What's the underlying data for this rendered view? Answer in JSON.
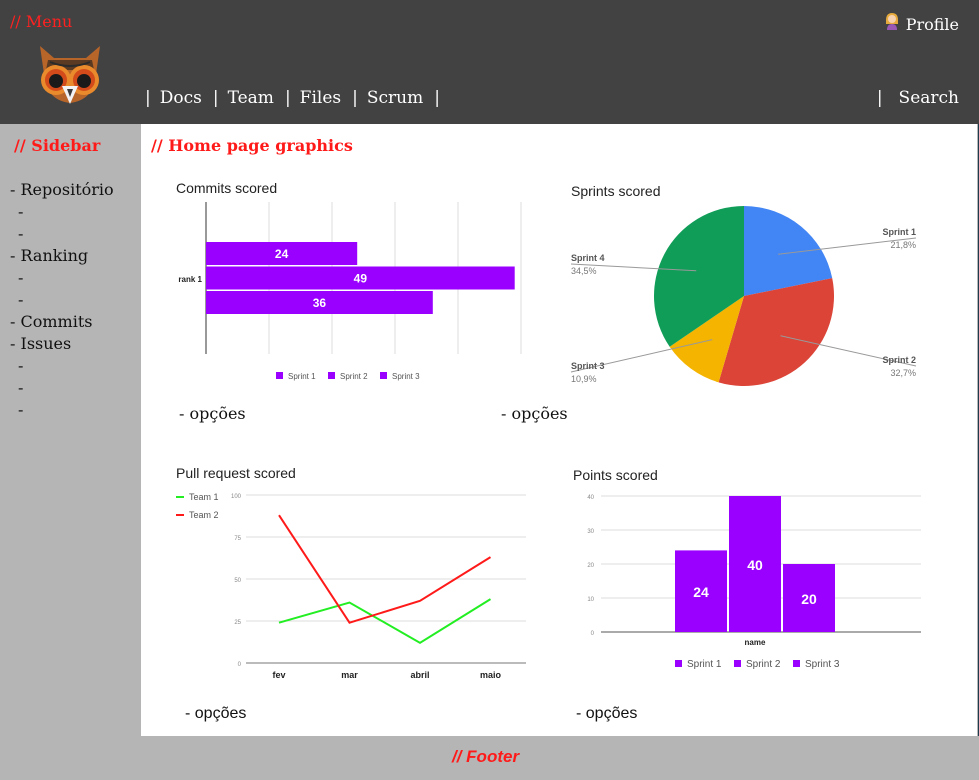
{
  "header": {
    "menu_label": "// Menu",
    "profile_label": "Profile",
    "nav": [
      "Docs",
      "Team",
      "Files",
      "Scrum"
    ],
    "search_label": "Search"
  },
  "sidebar": {
    "title": "// Sidebar",
    "items": [
      {
        "label": "- Repositório",
        "sub": false
      },
      {
        "label": "-",
        "sub": true
      },
      {
        "label": "-",
        "sub": true
      },
      {
        "label": "- Ranking",
        "sub": false
      },
      {
        "label": "-",
        "sub": true
      },
      {
        "label": "-",
        "sub": true
      },
      {
        "label": "- Commits",
        "sub": false
      },
      {
        "label": "- Issues",
        "sub": false
      },
      {
        "label": "-",
        "sub": true
      },
      {
        "label": "-",
        "sub": true
      },
      {
        "label": "-",
        "sub": true
      }
    ]
  },
  "main": {
    "title": "// Home page graphics",
    "options": [
      "- opções",
      "- opções",
      "- opções",
      "- opções"
    ]
  },
  "footer": {
    "label": "// Footer"
  },
  "colors": {
    "purple": "#9900ff",
    "sprint1": "#4285f4",
    "sprint2": "#db4437",
    "sprint3": "#f4b400",
    "sprint4": "#0f9d58",
    "team1": "#22ee22",
    "team2": "#ff1a1a"
  },
  "chart_data": [
    {
      "type": "bar",
      "orientation": "horizontal",
      "title": "Commits scored",
      "categories": [
        "rank 1"
      ],
      "series": [
        {
          "name": "Sprint 1",
          "values": [
            24
          ]
        },
        {
          "name": "Sprint 2",
          "values": [
            49
          ]
        },
        {
          "name": "Sprint 3",
          "values": [
            36
          ]
        }
      ],
      "xlim": [
        0,
        50
      ],
      "legend": "bottom"
    },
    {
      "type": "pie",
      "title": "Sprints scored",
      "slices": [
        {
          "name": "Sprint 1",
          "value": 21.8,
          "label": "21,8%"
        },
        {
          "name": "Sprint 2",
          "value": 32.7,
          "label": "32,7%"
        },
        {
          "name": "Sprint 3",
          "value": 10.9,
          "label": "10,9%"
        },
        {
          "name": "Sprint 4",
          "value": 34.5,
          "label": "34,5%"
        }
      ]
    },
    {
      "type": "line",
      "title": "Pull request scored",
      "categories": [
        "fev",
        "mar",
        "abril",
        "maio"
      ],
      "series": [
        {
          "name": "Team 1",
          "values": [
            24,
            36,
            12,
            38
          ]
        },
        {
          "name": "Team 2",
          "values": [
            88,
            24,
            37,
            63
          ]
        }
      ],
      "yticks": [
        0,
        25,
        50,
        75,
        100
      ],
      "ylim": [
        0,
        100
      ],
      "legend": "top-left"
    },
    {
      "type": "bar",
      "title": "Points scored",
      "categories": [
        "name"
      ],
      "xlabel": "name",
      "series": [
        {
          "name": "Sprint 1",
          "values": [
            24
          ]
        },
        {
          "name": "Sprint 2",
          "values": [
            40
          ]
        },
        {
          "name": "Sprint 3",
          "values": [
            20
          ]
        }
      ],
      "yticks": [
        0,
        10,
        20,
        30,
        40
      ],
      "ylim": [
        0,
        40
      ],
      "legend": "bottom"
    }
  ]
}
